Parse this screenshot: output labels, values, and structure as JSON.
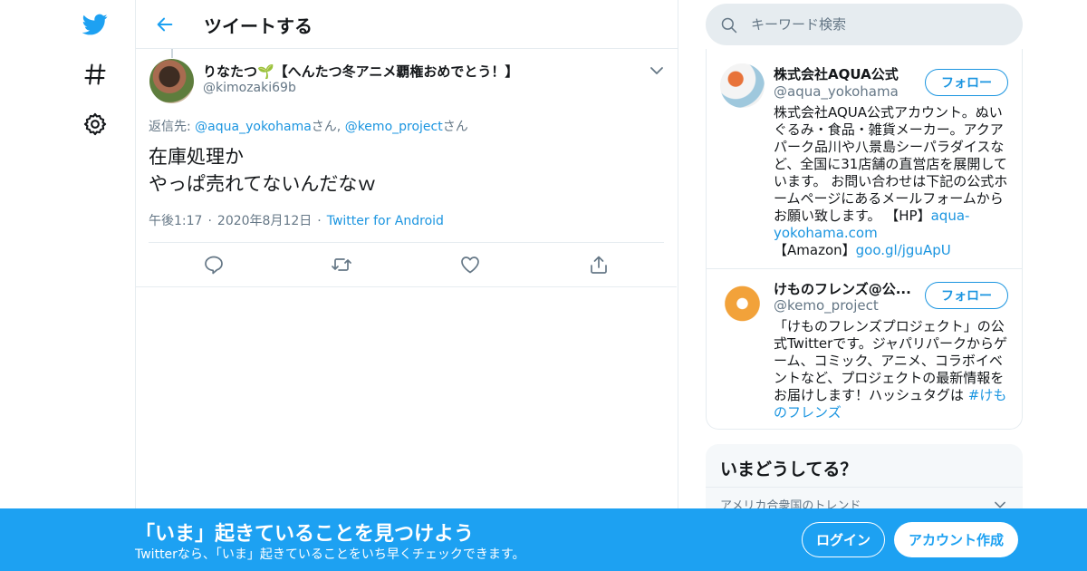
{
  "colors": {
    "accent": "#1da1f2",
    "link": "#1b95e0",
    "muted": "#657786",
    "border": "#e6ecf0"
  },
  "left_nav": {
    "icons": [
      "twitter-bird-icon",
      "hashtag-icon",
      "gear-icon"
    ]
  },
  "header": {
    "title": "ツイートする"
  },
  "tweet": {
    "author_name": "りなたつ🌱【へんたつ冬アニメ覇権おめでとう！】",
    "author_handle": "@kimozaki69b",
    "reply_prefix": "返信先: ",
    "reply_to": [
      {
        "handle": "@aqua_yokohama",
        "suffix": "さん, "
      },
      {
        "handle": "@kemo_project",
        "suffix": "さん"
      }
    ],
    "text_line1": "在庫処理か",
    "text_line2": "やっぱ売れてないんだなｗ",
    "time": "午後1:17",
    "date": "2020年8月12日",
    "source": "Twitter for Android",
    "separator": "·"
  },
  "search": {
    "placeholder": "キーワード検索"
  },
  "who_to_follow": [
    {
      "name": "株式会社AQUA公式",
      "handle": "@aqua_yokohama",
      "follow_label": "フォロー",
      "bio_line": "株式会社AQUA公式アカウント。ぬいぐるみ・食品・雑貨メーカー。アクアパーク品川や八景島シーパラダイスなど、全国に31店舗の直営店を展開しています。 お問い合わせは下記の公式ホームページにあるメールフォームからお願い致します。 【HP】",
      "bio_link1": "aqua-yokohama.com",
      "bio_amazon": "【Amazon】",
      "bio_link2": "goo.gl/jguApU"
    },
    {
      "name": "けものフレンズ@公...",
      "handle": "@kemo_project",
      "follow_label": "フォロー",
      "bio_line": "「けものフレンズプロジェクト」の公式Twitterです。ジャパリパークからゲーム、コミック、アニメ、コラボイベントなど、プロジェクトの最新情報をお届けします！ハッシュタグは ",
      "bio_link1": "#けものフレンズ"
    }
  ],
  "trends": {
    "title": "いまどうしてる？",
    "region": "アメリカ合衆国のトレンド"
  },
  "bottom_bar": {
    "title": "「いま」起きていることを見つけよう",
    "subtitle": "Twitterなら、「いま」起きていることをいち早くチェックできます。",
    "login_label": "ログイン",
    "signup_label": "アカウント作成"
  }
}
